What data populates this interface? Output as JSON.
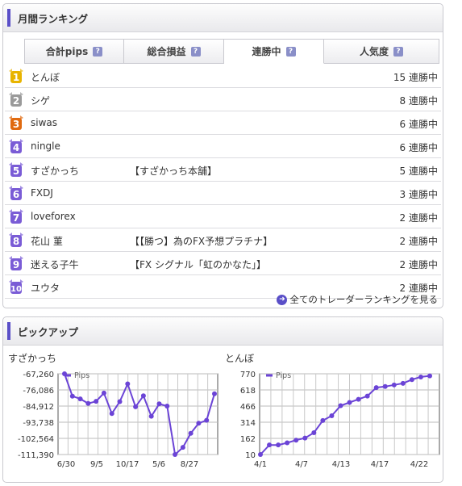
{
  "ranking": {
    "title": "月間ランキング",
    "tabs": [
      {
        "label": "合計pips",
        "help": "?"
      },
      {
        "label": "総合損益",
        "help": "?"
      },
      {
        "label": "連勝中",
        "help": "?"
      },
      {
        "label": "人気度",
        "help": "?"
      }
    ],
    "rows": [
      {
        "rank": "1",
        "name": "とんぼ",
        "sub": "",
        "streak": "15 連勝中"
      },
      {
        "rank": "2",
        "name": "シゲ",
        "sub": "",
        "streak": "8 連勝中"
      },
      {
        "rank": "3",
        "name": "siwas",
        "sub": "",
        "streak": "6 連勝中"
      },
      {
        "rank": "4",
        "name": "ningle",
        "sub": "",
        "streak": "6 連勝中"
      },
      {
        "rank": "5",
        "name": "すざかっち",
        "sub": "【すざかっち本舗】",
        "streak": "5 連勝中"
      },
      {
        "rank": "6",
        "name": "FXDJ",
        "sub": "",
        "streak": "3 連勝中"
      },
      {
        "rank": "7",
        "name": "loveforex",
        "sub": "",
        "streak": "2 連勝中"
      },
      {
        "rank": "8",
        "name": "花山 菫",
        "sub": "【【勝つ】為のFX予想プラチナ】",
        "streak": "2 連勝中"
      },
      {
        "rank": "9",
        "name": "迷える子牛",
        "sub": "【FX シグナル「虹のかなた」】",
        "streak": "2 連勝中"
      },
      {
        "rank": "10",
        "name": "ユウタ",
        "sub": "",
        "streak": "2 連勝中"
      }
    ],
    "all_link": "全てのトレーダーランキングを見る"
  },
  "pickup": {
    "title": "ピックアップ",
    "colors": {
      "line": "#6b44d6",
      "medal_gold": "#e8b400",
      "medal_silver": "#9a9a9a",
      "medal_bronze": "#e06a10",
      "medal_purple": "#7a5cd6"
    }
  },
  "chart_data": [
    {
      "type": "line",
      "title": "すざかっち",
      "legend": "Pips",
      "yticks": [
        "-67,260",
        "-76,086",
        "-84,912",
        "-93,738",
        "-102,564",
        "-111,390"
      ],
      "xticks": [
        "6/30",
        "9/5",
        "10/17",
        "5/6",
        "8/27"
      ],
      "ylim": [
        -111390,
        -67260
      ],
      "values": [
        -67260,
        -79500,
        -81000,
        -83500,
        -82300,
        -77800,
        -89000,
        -82500,
        -72800,
        -85300,
        -79300,
        -90500,
        -83700,
        -84900,
        -111390,
        -107500,
        -99800,
        -94300,
        -92700,
        -78200
      ]
    },
    {
      "type": "line",
      "title": "とんぼ",
      "legend": "Pips",
      "yticks": [
        "770",
        "618",
        "466",
        "314",
        "162",
        "10"
      ],
      "xticks": [
        "4/1",
        "4/7",
        "4/13",
        "4/17",
        "4/22"
      ],
      "ylim": [
        10,
        770
      ],
      "values": [
        10,
        100,
        100,
        120,
        145,
        165,
        215,
        330,
        375,
        470,
        500,
        530,
        560,
        640,
        650,
        665,
        680,
        715,
        740,
        750
      ]
    }
  ]
}
